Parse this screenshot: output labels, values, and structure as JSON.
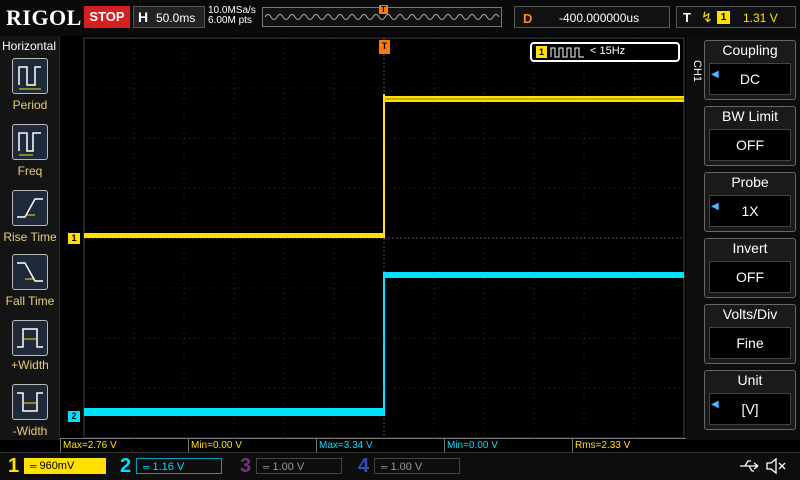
{
  "topbar": {
    "logo": "RIGOL",
    "run_state": "STOP",
    "timebase_label": "H",
    "timebase_value": "50.0ms",
    "sample_rate": "10.0MSa/s",
    "memory_depth": "6.00M pts",
    "trigger_marker": "T",
    "delay_label": "D",
    "delay_value": "-400.000000us",
    "trigger_label": "T",
    "trigger_edge_symbol": "↯",
    "trigger_source": "1",
    "trigger_level": "1.31 V"
  },
  "left_menu": {
    "title": "Horizontal",
    "items": [
      {
        "label": "Period"
      },
      {
        "label": "Freq"
      },
      {
        "label": "Rise Time"
      },
      {
        "label": "Fall Time"
      },
      {
        "label": "+Width"
      },
      {
        "label": "-Width"
      }
    ]
  },
  "counter": {
    "channel": "1",
    "value": "< 15Hz"
  },
  "ch_markers": {
    "ch1": "1",
    "ch2": "2"
  },
  "trigger_pos_marker": "T",
  "right_menu": {
    "channel_tab": "CH1",
    "items": [
      {
        "title": "Coupling",
        "value": "DC",
        "has_arrow": true
      },
      {
        "title": "BW Limit",
        "value": "OFF",
        "has_arrow": false
      },
      {
        "title": "Probe",
        "value": "1X",
        "has_arrow": true
      },
      {
        "title": "Invert",
        "value": "OFF",
        "has_arrow": false
      },
      {
        "title": "Volts/Div",
        "value": "Fine",
        "has_arrow": false
      },
      {
        "title": "Unit",
        "value": "[V]",
        "has_arrow": true
      }
    ]
  },
  "measurements": [
    {
      "label": "Max=2.76 V",
      "color": "#ffe000"
    },
    {
      "label": "Min=0.00 V",
      "color": "#ffe000"
    },
    {
      "label": "Max=3.34 V",
      "color": "#00e0ff"
    },
    {
      "label": "Min=0.00 V",
      "color": "#00e0ff"
    },
    {
      "label": "Rms=2.33 V",
      "color": "#ffe000"
    }
  ],
  "channels": [
    {
      "num": "1",
      "scale": "960mV",
      "color": "#ffe000",
      "active": true
    },
    {
      "num": "2",
      "scale": "1.16 V",
      "color": "#00e0ff",
      "active": true
    },
    {
      "num": "3",
      "scale": "1.00 V",
      "color": "#c040c0",
      "active": false
    },
    {
      "num": "4",
      "scale": "1.00 V",
      "color": "#4060ff",
      "active": false
    }
  ],
  "colors": {
    "ch1": "#ffe000",
    "ch2": "#00e0ff",
    "trigger": "#ff7a00",
    "stop": "#d42020"
  },
  "status_icons": [
    "usb-icon",
    "speaker-mute-icon"
  ]
}
